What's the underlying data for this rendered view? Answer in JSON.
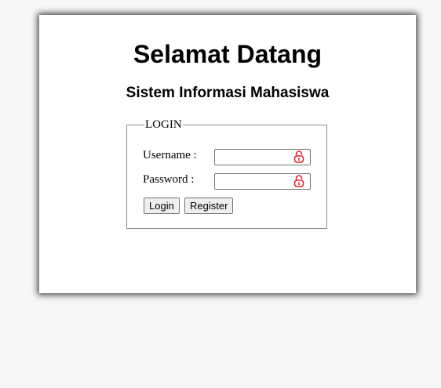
{
  "page": {
    "title": "Selamat Datang",
    "subtitle": "Sistem Informasi Mahasiswa"
  },
  "login": {
    "legend": "LOGIN",
    "username_label": "Username :",
    "username_value": "",
    "password_label": "Password :",
    "password_value": "",
    "login_button": "Login",
    "register_button": "Register",
    "field_icon": "padlock-icon"
  },
  "colors": {
    "background": "#f7f7f7",
    "card": "#ffffff",
    "lock_icon": "#e8202a"
  }
}
